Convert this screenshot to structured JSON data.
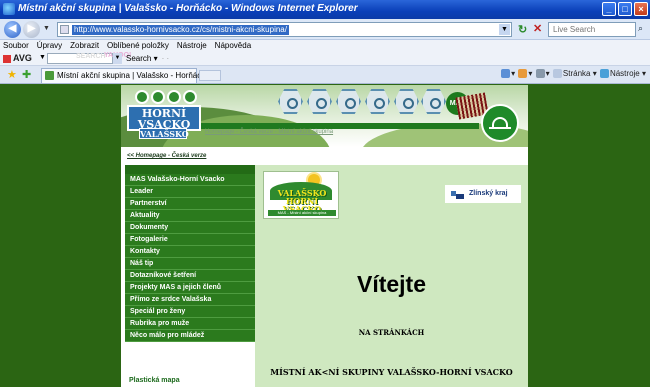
{
  "window": {
    "title": "Místní akční skupina | Valašsko - Horňácko - Windows Internet Explorer",
    "minimize": "_",
    "maximize": "□",
    "close": "×"
  },
  "address": {
    "url": "http://www.valassko-hornivsacko.cz/cs/mistni-akcni-skupina/",
    "search_placeholder": "Live Search"
  },
  "menu": [
    "Soubor",
    "Úpravy",
    "Zobrazit",
    "Oblíbené položky",
    "Nástroje",
    "Nápověda"
  ],
  "toolbar": {
    "avg_label": "AVG",
    "yahoo_label": "YAHOO!",
    "yahoo_search": "SEARCH",
    "search_label": "Search",
    "search_suffix": "· ·"
  },
  "tabs": {
    "active_tab": "Místní akční skupina | Valašsko - Horňácko",
    "right_tools": {
      "page": "Stránka",
      "tools": "Nástroje"
    }
  },
  "page": {
    "breadcrumb": "Homepage - Česká verze - Místní akční skupina",
    "top_link": "<< Homepage - Česká verze",
    "header_logo_line1": "HORNÍ VSACKO",
    "header_logo_line2": "VALAŠSKO",
    "mas_badge": "MAS",
    "nav_items": [
      "MAS Valašsko-Horní Vsacko",
      "Leader",
      "Partnerství",
      "Aktuality",
      "Dokumenty",
      "Fotogalerie",
      "Kontakty",
      "Náš tip",
      "Dotazníkové šetření",
      "Projekty MAS a jejich členů",
      "Přímo ze srdce Valašska",
      "Speciál pro ženy",
      "Rubrika pro muže",
      "Něco málo pro mládež"
    ],
    "sidebar_link": "Plastická mapa",
    "logo_main_line1": "VALAŠSKO",
    "logo_main_line2": "HORNÍ VSACKO",
    "logo_main_caption": "MAS - Místní akční skupina",
    "zlin_logo": "Zlínský kraj",
    "welcome": "Vítejte",
    "sub1": "NA STRÁNKÁCH",
    "sub2": "MÍSTNÍ AK<NÍ SKUPINY VALAŠSKO-HORNÍ VSACKO"
  }
}
